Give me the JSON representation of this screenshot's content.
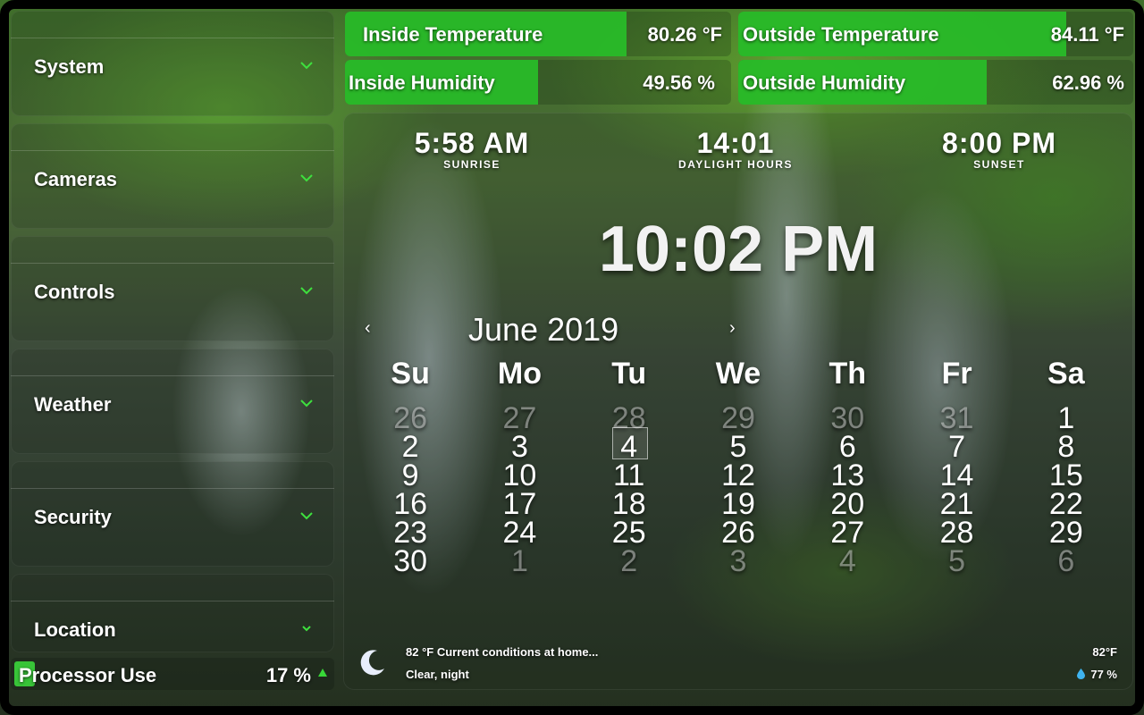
{
  "sidebar": {
    "items": [
      {
        "label": "System"
      },
      {
        "label": "Cameras"
      },
      {
        "label": "Controls"
      },
      {
        "label": "Weather"
      },
      {
        "label": "Security"
      },
      {
        "label": "Location"
      }
    ],
    "processor": {
      "label": "Processor Use",
      "value": "17 %",
      "percent": 17
    }
  },
  "sensors": {
    "inside_temp": {
      "label": "Inside Temperature",
      "value": "80.26 °F",
      "level": 0.73
    },
    "outside_temp": {
      "label": "Outside Temperature",
      "value": "84.11 °F",
      "level": 0.83
    },
    "inside_humidity": {
      "label": "Inside Humidity",
      "value": "49.56 %",
      "level": 0.5
    },
    "outside_humidity": {
      "label": "Outside Humidity",
      "value": "62.96 %",
      "level": 0.63
    }
  },
  "sun": {
    "sunrise": {
      "time": "5:58 AM",
      "label": "SUNRISE"
    },
    "daylight": {
      "time": "14:01",
      "label": "DAYLIGHT HOURS"
    },
    "sunset": {
      "time": "8:00 PM",
      "label": "SUNSET"
    }
  },
  "clock": {
    "time": "10:02 PM"
  },
  "calendar": {
    "title": "June 2019",
    "prev": "‹",
    "next": "›",
    "weekdays": [
      "Su",
      "Mo",
      "Tu",
      "We",
      "Th",
      "Fr",
      "Sa"
    ],
    "today": "4",
    "days": [
      {
        "d": "26",
        "m": true
      },
      {
        "d": "27",
        "m": true
      },
      {
        "d": "28",
        "m": true
      },
      {
        "d": "29",
        "m": true
      },
      {
        "d": "30",
        "m": true
      },
      {
        "d": "31",
        "m": true
      },
      {
        "d": "1",
        "m": false
      },
      {
        "d": "2",
        "m": false
      },
      {
        "d": "3",
        "m": false
      },
      {
        "d": "4",
        "m": false
      },
      {
        "d": "5",
        "m": false
      },
      {
        "d": "6",
        "m": false
      },
      {
        "d": "7",
        "m": false
      },
      {
        "d": "8",
        "m": false
      },
      {
        "d": "9",
        "m": false
      },
      {
        "d": "10",
        "m": false
      },
      {
        "d": "11",
        "m": false
      },
      {
        "d": "12",
        "m": false
      },
      {
        "d": "13",
        "m": false
      },
      {
        "d": "14",
        "m": false
      },
      {
        "d": "15",
        "m": false
      },
      {
        "d": "16",
        "m": false
      },
      {
        "d": "17",
        "m": false
      },
      {
        "d": "18",
        "m": false
      },
      {
        "d": "19",
        "m": false
      },
      {
        "d": "20",
        "m": false
      },
      {
        "d": "21",
        "m": false
      },
      {
        "d": "22",
        "m": false
      },
      {
        "d": "23",
        "m": false
      },
      {
        "d": "24",
        "m": false
      },
      {
        "d": "25",
        "m": false
      },
      {
        "d": "26",
        "m": false
      },
      {
        "d": "27",
        "m": false
      },
      {
        "d": "28",
        "m": false
      },
      {
        "d": "29",
        "m": false
      },
      {
        "d": "30",
        "m": false
      },
      {
        "d": "1",
        "m": true
      },
      {
        "d": "2",
        "m": true
      },
      {
        "d": "3",
        "m": true
      },
      {
        "d": "4",
        "m": true
      },
      {
        "d": "5",
        "m": true
      },
      {
        "d": "6",
        "m": true
      }
    ]
  },
  "weather": {
    "summary": "82 °F Current conditions at home...",
    "condition": "Clear, night",
    "temp": "82°F",
    "humidity": "77 %",
    "icon": "moon-icon"
  },
  "colors": {
    "accent": "#38c438",
    "chevron": "#3ee03e"
  }
}
